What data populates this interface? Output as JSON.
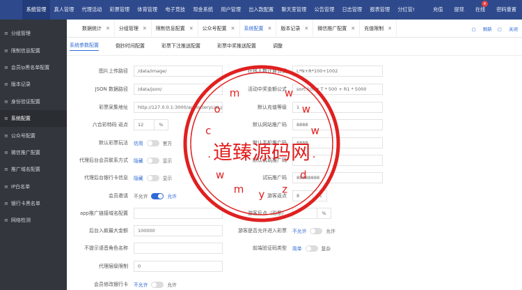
{
  "topnav": {
    "items": [
      "系统管理",
      "真人管理",
      "代理活动",
      "彩票管理",
      "体育管理",
      "电子竞技",
      "现金系统",
      "用户管理",
      "出入款配置",
      "聊天室管理",
      "公告管理",
      "日志管理",
      "报表管理",
      "分红管!"
    ],
    "right": [
      "充值",
      "提现",
      "在线",
      "密码重置"
    ],
    "badge": "4"
  },
  "sidebar": {
    "items": [
      "分组管理",
      "限制信息配置",
      "会员ip黑名单配置",
      "版本记录",
      "身份验证配置",
      "系统配置",
      "公众号配置",
      "微信推广配置",
      "推广域名配置",
      "IP白名单",
      "银行卡黑名单",
      "网络检测"
    ]
  },
  "tabs": {
    "items": [
      {
        "label": "数据统计"
      },
      {
        "label": "分组管理"
      },
      {
        "label": "限制信息配置"
      },
      {
        "label": "公众号配置"
      },
      {
        "label": "系统配置"
      },
      {
        "label": "版本记录"
      },
      {
        "label": "微信推广配置"
      },
      {
        "label": "充值限制"
      }
    ],
    "close": "✕",
    "refresh": "刷新",
    "close_all": "关闭"
  },
  "subtabs": [
    "系统参数配置",
    "倒抄时间配置",
    "彩票下注推送配置",
    "彩票中奖推送配置",
    "调整"
  ],
  "form_left": [
    {
      "label": "图片上传路径",
      "value": "/data/image/"
    },
    {
      "label": "JSON 数据路径",
      "value": "/data/json/"
    },
    {
      "label": "彩票采集地址",
      "value": "http://127.0.0.1:3000/api/lotteryList.php"
    },
    {
      "label": "六合彩特码 返点",
      "value": "12",
      "unit": "%"
    },
    {
      "label": "默认彩票玩法",
      "off": "信用",
      "on": "官方"
    },
    {
      "label": "代理后台会员联系方式",
      "off": "隐藏",
      "on": "显示"
    },
    {
      "label": "代理后台银行卡信息",
      "off": "隐藏",
      "on": "显示"
    },
    {
      "label": "会员邀请",
      "off": "不允许",
      "on": "允许"
    },
    {
      "label": "app推广链接域名配置",
      "value": ""
    },
    {
      "label": "后台入款最大金额",
      "value": "100000"
    },
    {
      "label": "不提示语音角色名称",
      "value": ""
    },
    {
      "label": "代理层级限制",
      "value": "0"
    },
    {
      "label": "会员修改银行卡",
      "off": "不允许",
      "on": "允许"
    }
  ],
  "form_right": [
    {
      "label": "在线人数计算公式",
      "value": "L*N+R*100+1002"
    },
    {
      "label": "活动中奖金额公式",
      "value": "sort:100 * T * 500 + R1 * 5000"
    },
    {
      "label": "默认充值等级",
      "value": "1"
    },
    {
      "label": "默认网站推广码",
      "value": "8888"
    },
    {
      "label": "默认手机推广码",
      "value": "8888"
    },
    {
      "label": "默认试玩推广码",
      "value": ""
    },
    {
      "label": "试玩推广码",
      "value": "88888888"
    },
    {
      "label": "游客返点",
      "value": "8",
      "unit": "%"
    },
    {
      "label": "游客反点（彩票）",
      "value": "",
      "unit": "%"
    },
    {
      "label": "游客是否允许进入彩票",
      "off": "不允许",
      "on": "允许"
    },
    {
      "label": "前端验证码类型",
      "off": "简单",
      "on": "复杂"
    }
  ],
  "watermark": {
    "text": "道臻源码网",
    "ring": "www.dzymw.com"
  },
  "colors": {
    "topbar": "#2f4a8c",
    "sidebar": "#33373d",
    "accent": "#2f6bd6",
    "watermark": "#e02020"
  }
}
